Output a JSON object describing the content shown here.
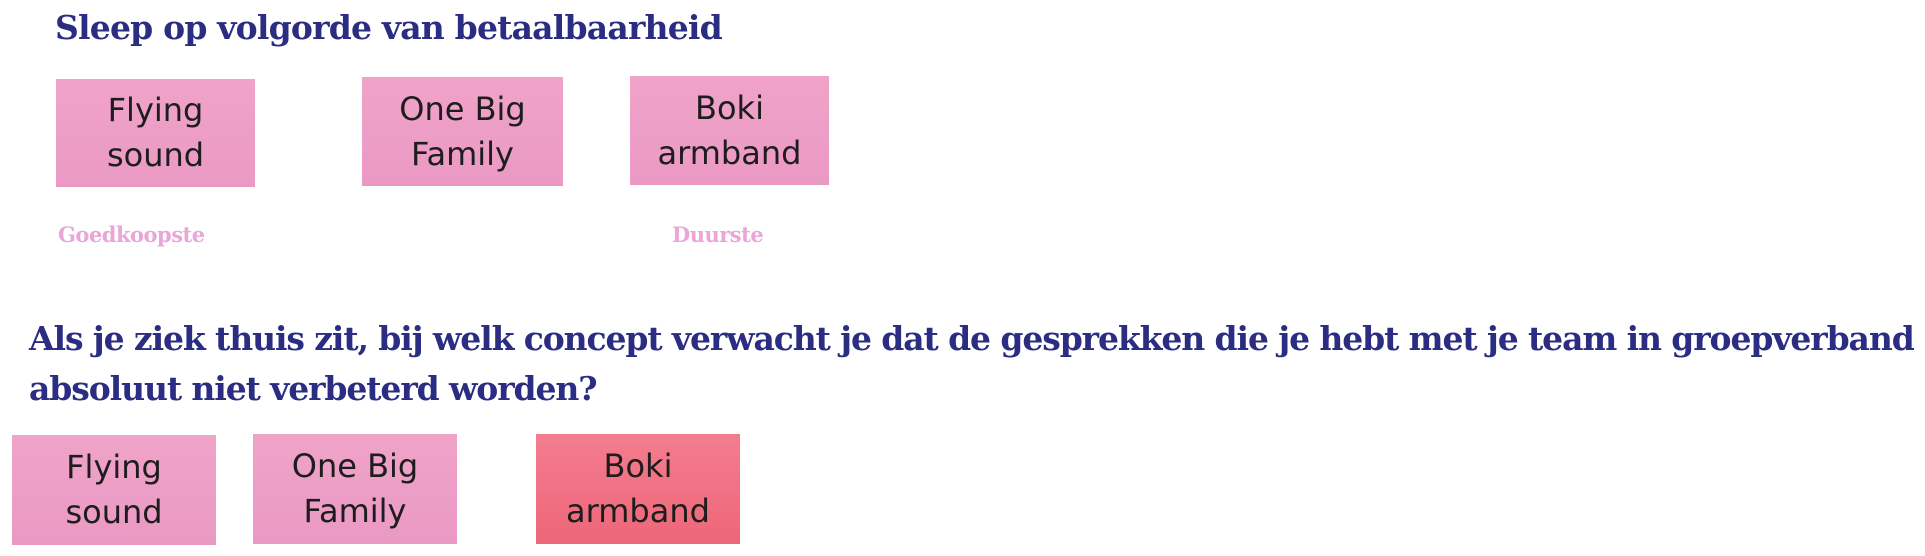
{
  "section1": {
    "title": "Sleep op volgorde van betaalbaarheid",
    "notes": [
      {
        "line1": "Flying",
        "line2": "sound"
      },
      {
        "line1": "One Big",
        "line2": "Family"
      },
      {
        "line1": "Boki",
        "line2": "armband"
      }
    ],
    "label_cheapest": "Goedkoopste",
    "label_most_expensive": "Duurste"
  },
  "section2": {
    "question": "Als je ziek thuis zit, bij welk concept verwacht je dat de gesprekken die je hebt met je team in groepverband absoluut niet verbeterd worden?",
    "notes": [
      {
        "line1": "Flying",
        "line2": "sound"
      },
      {
        "line1": "One Big",
        "line2": "Family"
      },
      {
        "line1": "Boki",
        "line2": "armband"
      }
    ]
  },
  "colors": {
    "heading": "#2b2d82",
    "note_pink": "#ed9ec6",
    "note_red": "#f07284",
    "label": "#e9a6d6"
  }
}
